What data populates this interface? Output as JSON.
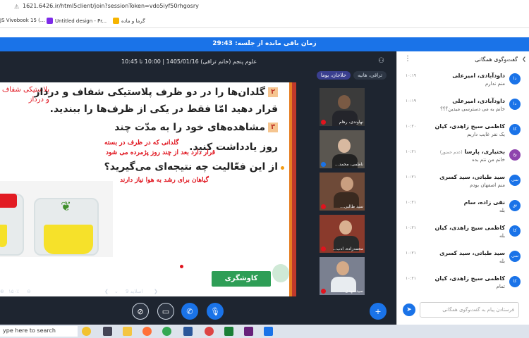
{
  "browser": {
    "url": "1621.6426.ir/html5client/join?sessionToken=vdo5iyf50rhgosry",
    "bookmarks": [
      "JS Vivobook 15 (...",
      "Untitled design - Pr...",
      "گرما و ماده"
    ]
  },
  "timer": {
    "text": "زمان باقی مانده از جلسه: 29:43"
  },
  "session": {
    "info": "علوم پنجم (خانم تراقی) 1405/01/16 | 10:00 تا 10:45"
  },
  "pills": [
    {
      "label": "تراقی، هانیه",
      "active": false
    },
    {
      "label": "حلاجان، یوما",
      "active": true
    }
  ],
  "slide": {
    "corner_text": "پلاستیکی شفاف و درداز",
    "line1": "گلدان‌ها را در دو ظرف پلاستیکی شفاف و درداز",
    "line2": "قرار دهید امّا فقط در یکی از ظرف‌ها را ببندید.",
    "line3": "مشاهده‌های خود را به مدّت چند",
    "line4": "روز یادداشت کنید.",
    "line5": "از این فعّالیت چه نتیجه‌ای می‌گیرید؟",
    "num2": "۲",
    "num3": "۳",
    "hand1": "گلدانی که در ظرف در بسته",
    "hand2": "قرار دارد بعد از چند روز پژمرده می شود",
    "hand3": "گیاهان برای رشد به هوا نیاز دارند",
    "green_label": "کاوشگری"
  },
  "slide_controls": {
    "slide_label": "اسلاید 9",
    "zoom": "۱۵۰٪"
  },
  "videos": [
    {
      "name": "نهاوندی، رهام"
    },
    {
      "name": "ناظمی، محمد..."
    },
    {
      "name": "سید طالبی..."
    },
    {
      "name": "محمدزاده، آدب..."
    },
    {
      "name": "سید مهدی ..."
    }
  ],
  "chat": {
    "title": "گفت‌وگوی همگانی",
    "input_placeholder": "فرستادن پیام به گفت‌وگوی همگانی",
    "messages": [
      {
        "avatar": "دا",
        "name": "داودآبادی، امیرعلی",
        "time": "۱۰:۱۹",
        "text": "منم ندارم"
      },
      {
        "avatar": "دا",
        "name": "داودآبادی، امیرعلی",
        "time": "۱۰:۱۹",
        "text": "خانم به می دسترسی میدین؟؟؟"
      },
      {
        "avatar": "کا",
        "name": "کاظمی سیج زاهدی، کیان",
        "time": "۱۰:۲۰",
        "text": "یک نفر غایب داریم"
      },
      {
        "avatar": "بخ",
        "name": "بختیاری، پارسا",
        "name_note": "(عدم حضور)",
        "time": "۱۰:۲۱",
        "text": "خانم من نتم بده",
        "purple": true
      },
      {
        "avatar": "سی",
        "name": "سید طباتی، سید کسری",
        "time": "۱۰:۲۱",
        "text": "منم اصفهان بودم"
      },
      {
        "avatar": "نق",
        "name": "نقی زاده، سام",
        "time": "۱۰:۲۱",
        "text": "بله"
      },
      {
        "avatar": "کا",
        "name": "کاظمی سیج زاهدی، کیان",
        "time": "۱۰:۲۱",
        "text": "بله"
      },
      {
        "avatar": "سی",
        "name": "سید طباتی، سید کسری",
        "time": "۱۰:۲۱",
        "text": "بله"
      },
      {
        "avatar": "کا",
        "name": "کاظمی سیج زاهدی، کیان",
        "time": "۱۰:۲۱",
        "text": "تمام"
      }
    ]
  },
  "taskbar": {
    "search_text": "ype here to search"
  }
}
